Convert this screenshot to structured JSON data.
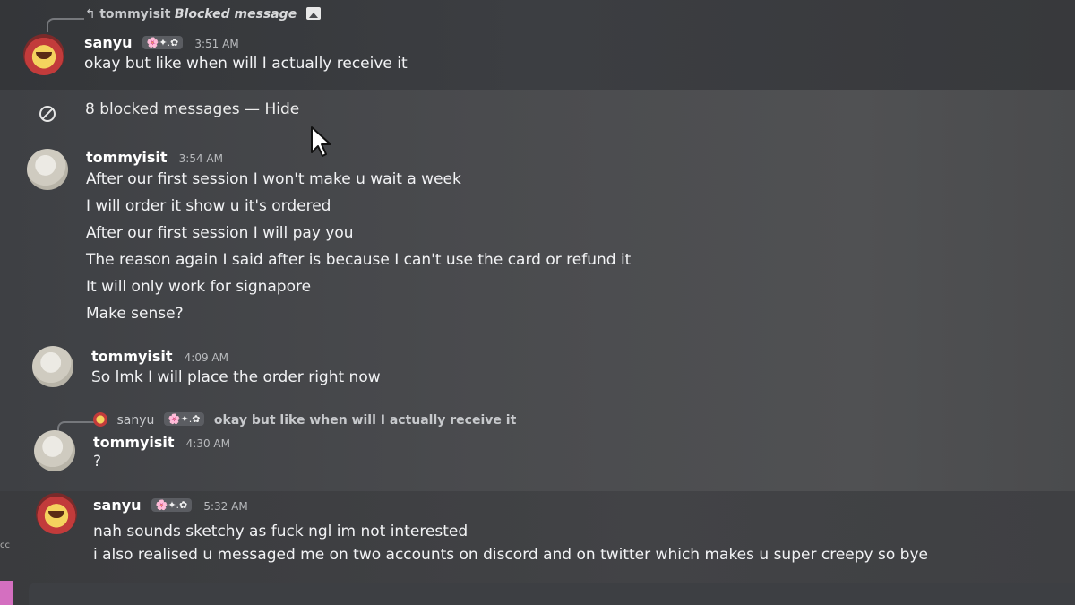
{
  "reply_top": {
    "author": "tommyisit",
    "text": "Blocked message",
    "icon": "image-icon"
  },
  "msg_sanyu_1": {
    "author": "sanyu",
    "badge": "🌸✦.✿",
    "time": "3:51 AM",
    "lines": [
      "okay but like when will I actually receive it"
    ]
  },
  "blocked": {
    "text": "8 blocked messages — Hide",
    "icon": "block-icon"
  },
  "msg_tommy_1": {
    "author": "tommyisit",
    "time": "3:54 AM",
    "lines": [
      "After our first session I won't make u wait a week",
      "I will order it show u it's ordered",
      "After our first session I will pay you",
      "The reason again I said after is because I can't use the card or refund it",
      "It will only work for signapore",
      "Make sense?"
    ]
  },
  "msg_tommy_2": {
    "author": "tommyisit",
    "time": "4:09 AM",
    "lines": [
      "So lmk I will place the order right now"
    ]
  },
  "reply_mid": {
    "author": "sanyu",
    "badge": "🌸✦.✿",
    "text": "okay but like when will I actually receive it"
  },
  "msg_tommy_3": {
    "author": "tommyisit",
    "time": "4:30 AM",
    "lines": [
      "?"
    ]
  },
  "msg_sanyu_2": {
    "author": "sanyu",
    "badge": "🌸✦.✿",
    "time": "5:32 AM",
    "lines": [
      "nah sounds sketchy as fuck ngl im not interested",
      "i also realised u messaged me on two accounts on discord and on twitter which makes u super creepy so bye"
    ]
  },
  "edge_text": "cc"
}
